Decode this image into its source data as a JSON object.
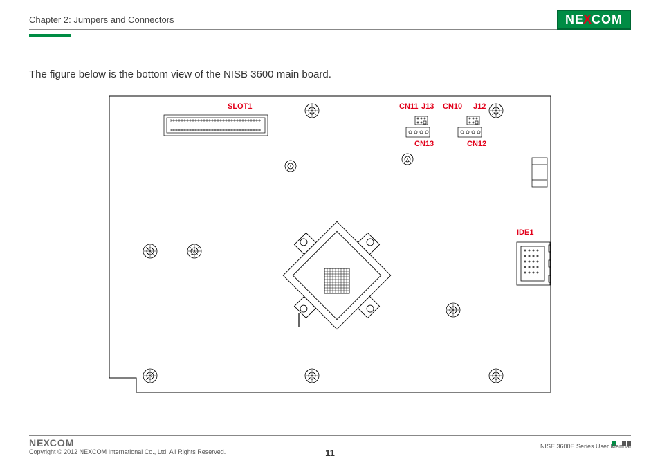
{
  "header": {
    "chapter_title": "Chapter 2: Jumpers and Connectors",
    "logo_pre": "NE",
    "logo_x": "X",
    "logo_post": "COM"
  },
  "intro": "The figure below is the bottom view of the NISB 3600 main board.",
  "board_labels": {
    "slot1": "SLOT1",
    "cn11": "CN11",
    "j13": "J13",
    "cn10": "CN10",
    "j12": "J12",
    "cn13": "CN13",
    "cn12": "CN12",
    "ide1": "IDE1"
  },
  "footer": {
    "logo_pre": "NE",
    "logo_x": "X",
    "logo_post": "COM",
    "copyright": "Copyright © 2012 NEXCOM International Co., Ltd. All Rights Reserved.",
    "manual": "NISE 3600E Series User Manual",
    "page_number": "11"
  }
}
